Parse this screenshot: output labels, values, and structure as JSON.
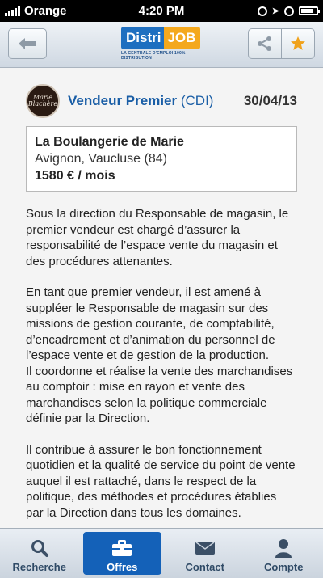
{
  "status": {
    "carrier": "Orange",
    "time": "4:20 PM",
    "battery_level": 0.85
  },
  "header": {
    "logo_left": "Distri",
    "logo_right": "JOB",
    "logo_tagline": "LA CENTRALE D'EMPLOI 100% DISTRIBUTION"
  },
  "job": {
    "company_logo_text": "Marie Blachère",
    "title": "Vendeur Premier",
    "contract": "(CDI)",
    "date": "30/04/13",
    "company": "La Boulangerie de Marie",
    "location": "Avignon, Vaucluse (84)",
    "salary": "1580 € / mois"
  },
  "description": {
    "p1": "Sous la direction du Responsable de magasin, le premier vendeur est chargé d’assurer la responsabilité de l’espace vente du magasin et des procédures attenantes.",
    "p2a": "En tant que premier vendeur, il est amené à suppléer le Responsable de magasin sur des missions de gestion courante, de comptabilité, d’encadrement et d’animation du personnel de l’espace vente et de gestion de la production.",
    "p2b": "Il coordonne et réalise la vente des marchandises au comptoir : mise en rayon et vente des marchandises selon la politique commerciale définie par la Direction.",
    "p3": "Il contribue à assurer le bon fonctionnement quotidien et la qualité de service du point de vente auquel il est rattaché, dans le respect de la politique, des méthodes et procédures établies par la Direction dans tous les domaines."
  },
  "tabs": {
    "search": "Recherche",
    "offers": "Offres",
    "contact": "Contact",
    "account": "Compte"
  },
  "colors": {
    "accent": "#1461b8",
    "title": "#1a5ea6",
    "brand_orange": "#f4a81d"
  }
}
